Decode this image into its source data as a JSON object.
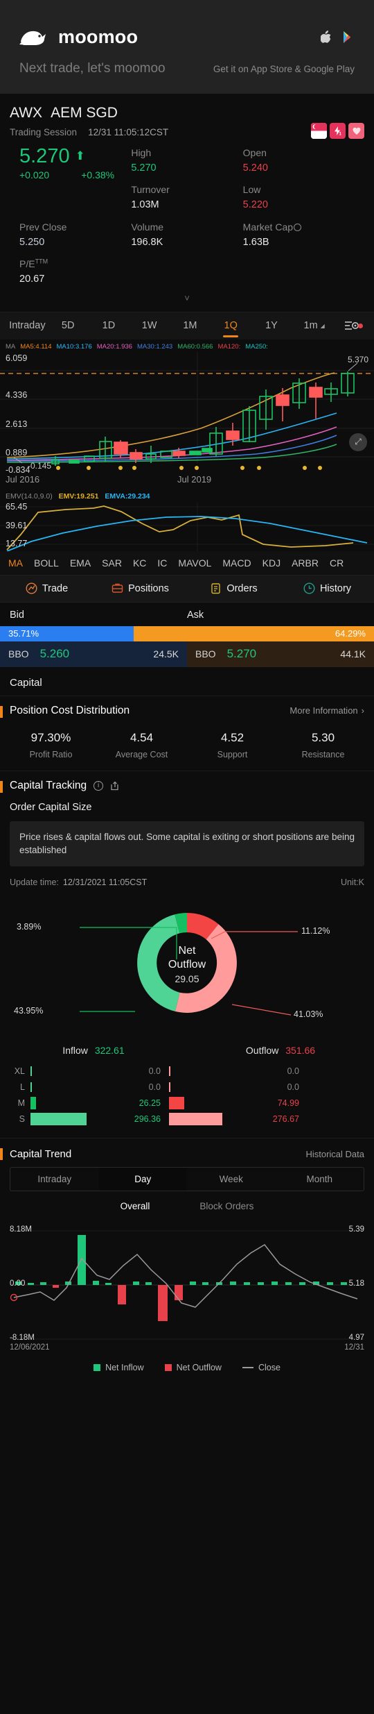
{
  "promo": {
    "brand": "moomoo",
    "tagline": "Next trade, let's moomoo",
    "get_text": "Get it on App Store & Google Play",
    "apple_icon": "apple-icon",
    "play_icon": "google-play-icon"
  },
  "quote": {
    "symbol": "AWX",
    "name": "AEM SGD",
    "session_label": "Trading Session",
    "session_time": "12/31 11:05:12CST",
    "last_price": "5.270",
    "arrow": "↑",
    "change": "+0.020",
    "change_pct": "+0.38%",
    "badges": [
      "sg-flag-badge",
      "leverage-badge",
      "favorite-badge"
    ],
    "stats": [
      {
        "label": "High",
        "value": "5.270",
        "tone": "up"
      },
      {
        "label": "Open",
        "value": "5.240",
        "tone": "down"
      },
      {
        "label": "Turnover",
        "value": "1.03M",
        "tone": "plain"
      },
      {
        "label": "Low",
        "value": "5.220",
        "tone": "down"
      },
      {
        "label": "Prev Close",
        "value": "5.250",
        "tone": "blue"
      },
      {
        "label": "Volume",
        "value": "196.8K",
        "tone": "plain"
      },
      {
        "label": "Market Cap",
        "value": "1.63B",
        "tone": "plain"
      },
      {
        "label": "P/E",
        "value": "20.67",
        "tone": "plain",
        "sup": "TTM"
      }
    ]
  },
  "periods": {
    "items": [
      {
        "label": "Intraday",
        "active": false
      },
      {
        "label": "5D",
        "active": false
      },
      {
        "label": "1D",
        "active": false
      },
      {
        "label": "1W",
        "active": false
      },
      {
        "label": "1M",
        "active": false
      },
      {
        "label": "1Q",
        "active": true
      },
      {
        "label": "1Y",
        "active": false
      },
      {
        "label": "1m",
        "active": false
      }
    ],
    "settings_icon": "chart-settings-icon"
  },
  "ma_legend": [
    {
      "text": "MA",
      "color": "#8a8a8a"
    },
    {
      "text": "MA5:4.114",
      "color": "#f0861a"
    },
    {
      "text": "MA10:3.176",
      "color": "#29b6f6"
    },
    {
      "text": "MA20:1.936",
      "color": "#e060c0"
    },
    {
      "text": "MA30:1.243",
      "color": "#3f7fe0"
    },
    {
      "text": "MA60:0.566",
      "color": "#2fb36a"
    },
    {
      "text": "MA120:",
      "color": "#e8414b"
    },
    {
      "text": "MA250:",
      "color": "#19c2c2"
    }
  ],
  "kchart": {
    "y_labels": [
      "6.059",
      "4.336",
      "2.613",
      "0.889",
      "-0.834"
    ],
    "marker_high": "5.370",
    "marker_low": "-0.145",
    "x_labels": [
      "Jul 2016",
      "Jul 2019"
    ],
    "expand_icon": "expand-chart-icon"
  },
  "emv": {
    "title": "EMV(14.0,9.0)",
    "emv_value": "EMV:19.251",
    "emva_value": "EMVA:29.234",
    "y_labels": [
      "65.45",
      "39.61",
      "13.77"
    ]
  },
  "indicator_tabs": [
    {
      "label": "MA",
      "active": true
    },
    {
      "label": "BOLL",
      "active": false
    },
    {
      "label": "EMA",
      "active": false
    },
    {
      "label": "SAR",
      "active": false
    },
    {
      "label": "KC",
      "active": false
    },
    {
      "label": "IC",
      "active": false
    },
    {
      "label": "MAVOL",
      "active": false
    },
    {
      "label": "MACD",
      "active": false
    },
    {
      "label": "KDJ",
      "active": false
    },
    {
      "label": "ARBR",
      "active": false
    },
    {
      "label": "CR",
      "active": false
    }
  ],
  "trade_row": [
    {
      "label": "Trade",
      "icon": "trade-icon"
    },
    {
      "label": "Positions",
      "icon": "positions-icon"
    },
    {
      "label": "Orders",
      "icon": "orders-icon"
    },
    {
      "label": "History",
      "icon": "history-clock-icon"
    }
  ],
  "bidask": {
    "bid_label": "Bid",
    "ask_label": "Ask",
    "bid_pct": "35.71%",
    "ask_pct": "64.29%",
    "bid_pct_num": 35.71,
    "ask_pct_num": 64.29,
    "bbo_label": "BBO",
    "bid_price": "5.260",
    "bid_qty": "24.5K",
    "ask_price": "5.270",
    "ask_qty": "44.1K"
  },
  "capital": {
    "section_title": "Capital",
    "pcd_title": "Position Cost Distribution",
    "pcd_more": "More Information",
    "pcd_chevron": "chevron-right-icon",
    "pcd_metrics": [
      {
        "value": "97.30%",
        "label": "Profit Ratio"
      },
      {
        "value": "4.54",
        "label": "Average Cost"
      },
      {
        "value": "4.52",
        "label": "Support"
      },
      {
        "value": "5.30",
        "label": "Resistance"
      }
    ],
    "tracking_title": "Capital Tracking",
    "info_icon": "info-icon",
    "share_icon": "share-icon",
    "order_size_title": "Order Capital Size",
    "note": "Price rises & capital flows out. Some capital is exiting or short positions are being established",
    "update_label": "Update time:",
    "update_time": "12/31/2021 11:05CST",
    "unit": "Unit:K"
  },
  "chart_data": [
    {
      "type": "pie",
      "title": "Order Capital Size",
      "center_title": "Net Outflow",
      "center_value": "29.05",
      "labels": [
        "3.89%",
        "11.12%",
        "41.03%",
        "43.95%"
      ],
      "slices": [
        {
          "label": "43.95%",
          "value": 43.95,
          "color": "#4fd495",
          "name": "inflow-small"
        },
        {
          "label": "3.89%",
          "value": 3.89,
          "color": "#16c060",
          "name": "inflow-medium"
        },
        {
          "label": "11.12%",
          "value": 11.12,
          "color": "#f44545",
          "name": "outflow-medium"
        },
        {
          "label": "41.03%",
          "value": 41.03,
          "color": "#ff9b9b",
          "name": "outflow-small"
        }
      ]
    },
    {
      "type": "bar",
      "title": "Inflow / Outflow by order size",
      "inflow_label": "Inflow",
      "inflow_total": "322.61",
      "outflow_label": "Outflow",
      "outflow_total": "351.66",
      "categories": [
        "XL",
        "L",
        "M",
        "S"
      ],
      "series": [
        {
          "name": "Inflow",
          "values": [
            0.0,
            0.0,
            26.25,
            296.36
          ],
          "labels": [
            "0.0",
            "0.0",
            "26.25",
            "296.36"
          ],
          "color": "#4fd495"
        },
        {
          "name": "Outflow",
          "values": [
            0.0,
            0.0,
            74.99,
            276.67
          ],
          "labels": [
            "0.0",
            "0.0",
            "74.99",
            "276.67"
          ],
          "color": "#ff9b9b"
        }
      ]
    },
    {
      "type": "bar",
      "title": "Capital Trend",
      "ylabel_top": "8.18M",
      "ylabel_zero": "0.00",
      "ylabel_bottom": "-8.18M",
      "y2_top": "5.39",
      "y2_mid": "5.18",
      "y2_bottom": "4.97",
      "xlabel_left": "12/06/2021",
      "xlabel_right": "12/31",
      "ylim": [
        -8180000,
        8180000
      ],
      "y2lim": [
        4.97,
        5.39
      ],
      "series": [
        {
          "name": "Net Inflow",
          "color": "#1fc77b",
          "values": [
            0.3,
            0.1,
            0.2,
            -0.1,
            0.15,
            8.18,
            0.4,
            0.2,
            -2.6,
            0.3,
            0.2,
            -5.1,
            -2.0,
            0.3,
            0.25,
            0.2,
            0.3,
            0.2,
            0.25,
            0.3
          ]
        },
        {
          "name": "Close",
          "color": "#9a9a9a",
          "values": [
            5.02,
            5.03,
            5.05,
            5.0,
            5.07,
            5.2,
            5.1,
            5.08,
            5.15,
            5.22,
            5.17,
            5.1,
            5.0,
            4.99,
            5.05,
            5.12,
            5.2,
            5.26,
            5.3,
            5.18
          ]
        }
      ],
      "legend": [
        {
          "label": "Net Inflow",
          "color": "#1fc77b",
          "shape": "square"
        },
        {
          "label": "Net Outflow",
          "color": "#e8414b",
          "shape": "square"
        },
        {
          "label": "Close",
          "color": "#9a9a9a",
          "shape": "line"
        }
      ]
    }
  ],
  "capital_trend": {
    "title": "Capital Trend",
    "historical": "Historical Data",
    "range_tabs": [
      {
        "label": "Intraday",
        "active": false
      },
      {
        "label": "Day",
        "active": true
      },
      {
        "label": "Week",
        "active": false
      },
      {
        "label": "Month",
        "active": false
      }
    ],
    "sub_tabs": [
      {
        "label": "Overall",
        "active": true
      },
      {
        "label": "Block Orders",
        "active": false
      }
    ]
  }
}
